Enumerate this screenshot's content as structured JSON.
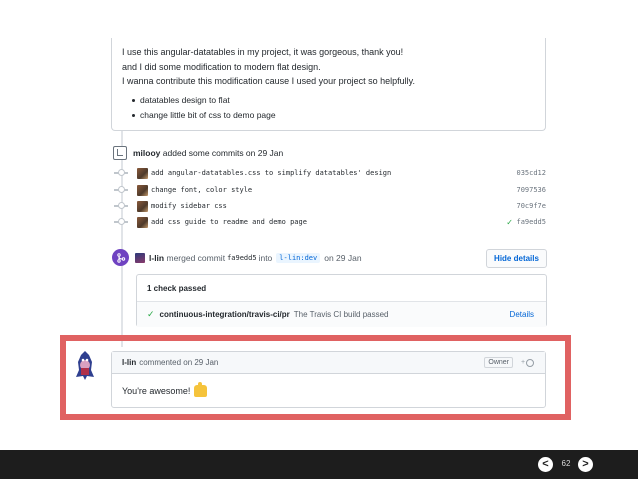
{
  "comment": {
    "lines": [
      "I use this angular-datatables in my project, it was gorgeous, thank you!",
      "and I did some modification to modern flat design.",
      "I wanna contribute this modification cause I used your project so helpfully."
    ],
    "bullets": [
      "datatables design to flat",
      "change little bit of css to demo page"
    ]
  },
  "commits_header": {
    "user": "milooy",
    "text": "added some commits on 29 Jan"
  },
  "commits": [
    {
      "message": "add angular-datatables.css to simplify datatables' design",
      "sha": "035cd12"
    },
    {
      "message": "change font, color style",
      "sha": "7097536"
    },
    {
      "message": "modify sidebar css",
      "sha": "70c9f7e"
    },
    {
      "message": "add css guide to readme and demo page",
      "sha": "fa9edd5",
      "check": "✓"
    }
  ],
  "merge": {
    "user": "l-lin",
    "text_before": "merged commit",
    "sha": "fa9edd5",
    "text_into": "into",
    "branch": "l-lin:dev",
    "date": "on 29 Jan",
    "button": "Hide details"
  },
  "checks": {
    "title": "1 check passed",
    "name": "continuous-integration/travis-ci/pr",
    "description": "The Travis CI build passed",
    "details": "Details",
    "check": "✓"
  },
  "bottom_comment": {
    "user": "l-lin",
    "meta": "commented on 29 Jan",
    "owner_badge": "Owner",
    "react_plus": "+",
    "body": "You're awesome!"
  },
  "slide": {
    "page": "62",
    "prev": "<",
    "next": ">"
  },
  "colors": {
    "highlight": "#e06262",
    "merge": "#6f42c1",
    "link": "#0366d6",
    "success": "#28a745"
  }
}
